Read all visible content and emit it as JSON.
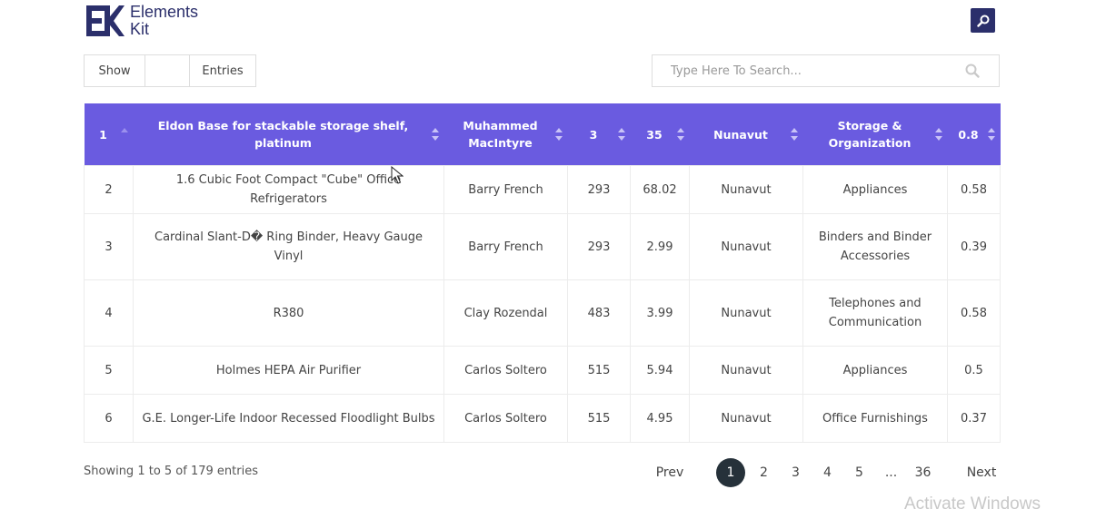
{
  "brand": {
    "name_line1": "Elements",
    "name_line2": "Kit",
    "accent": "#2b2f6b",
    "header_color": "#6a5be0"
  },
  "top_search_button": {
    "icon": "search-icon"
  },
  "length_control": {
    "show_label": "Show",
    "value": "",
    "entries_label": "Entries"
  },
  "search": {
    "placeholder": "Type Here To Search...",
    "icon": "search-icon"
  },
  "table": {
    "headers": [
      "1",
      "Eldon Base for stackable storage shelf, platinum",
      "Muhammed MacIntyre",
      "3",
      "35",
      "Nunavut",
      "Storage & Organization",
      "0.8"
    ],
    "rows": [
      [
        "2",
        "1.6 Cubic Foot Compact \"Cube\" Office Refrigerators",
        "Barry French",
        "293",
        "68.02",
        "Nunavut",
        "Appliances",
        "0.58"
      ],
      [
        "3",
        "Cardinal Slant-D� Ring Binder, Heavy Gauge Vinyl",
        "Barry French",
        "293",
        "2.99",
        "Nunavut",
        "Binders and Binder Accessories",
        "0.39"
      ],
      [
        "4",
        "R380",
        "Clay Rozendal",
        "483",
        "3.99",
        "Nunavut",
        "Telephones and Communication",
        "0.58"
      ],
      [
        "5",
        "Holmes HEPA Air Purifier",
        "Carlos Soltero",
        "515",
        "5.94",
        "Nunavut",
        "Appliances",
        "0.5"
      ],
      [
        "6",
        "G.E. Longer-Life Indoor Recessed Floodlight Bulbs",
        "Carlos Soltero",
        "515",
        "4.95",
        "Nunavut",
        "Office Furnishings",
        "0.37"
      ]
    ]
  },
  "footer": {
    "info": "Showing 1 to 5 of 179 entries",
    "prev": "Prev",
    "pages": [
      "1",
      "2",
      "3",
      "4",
      "5",
      "...",
      "36"
    ],
    "next": "Next",
    "active_page": "1"
  },
  "watermark": "Activate Windows"
}
